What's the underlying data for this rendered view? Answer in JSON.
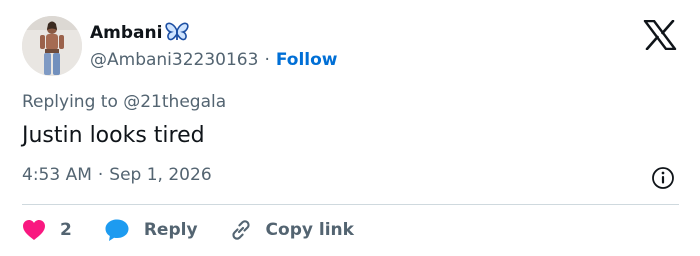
{
  "author": {
    "display_name": "Ambani",
    "handle": "@Ambani32230163",
    "separator": "·",
    "follow_label": "Follow",
    "butterfly_color": "#1d4fa3"
  },
  "tweet": {
    "replying_to": "Replying to @21thegala",
    "text": "Justin looks tired",
    "time": "4:53 AM",
    "separator": "·",
    "date": "Sep 1, 2026"
  },
  "actions": {
    "like_count": "2",
    "reply_label": "Reply",
    "copy_link_label": "Copy link"
  },
  "colors": {
    "like": "#f91880",
    "reply": "#1d9bf0",
    "follow": "#006fd6",
    "secondary_text": "#536471"
  },
  "icons": [
    "butterfly-icon",
    "x-logo-icon",
    "info-icon",
    "heart-icon",
    "reply-bubble-icon",
    "link-icon"
  ]
}
